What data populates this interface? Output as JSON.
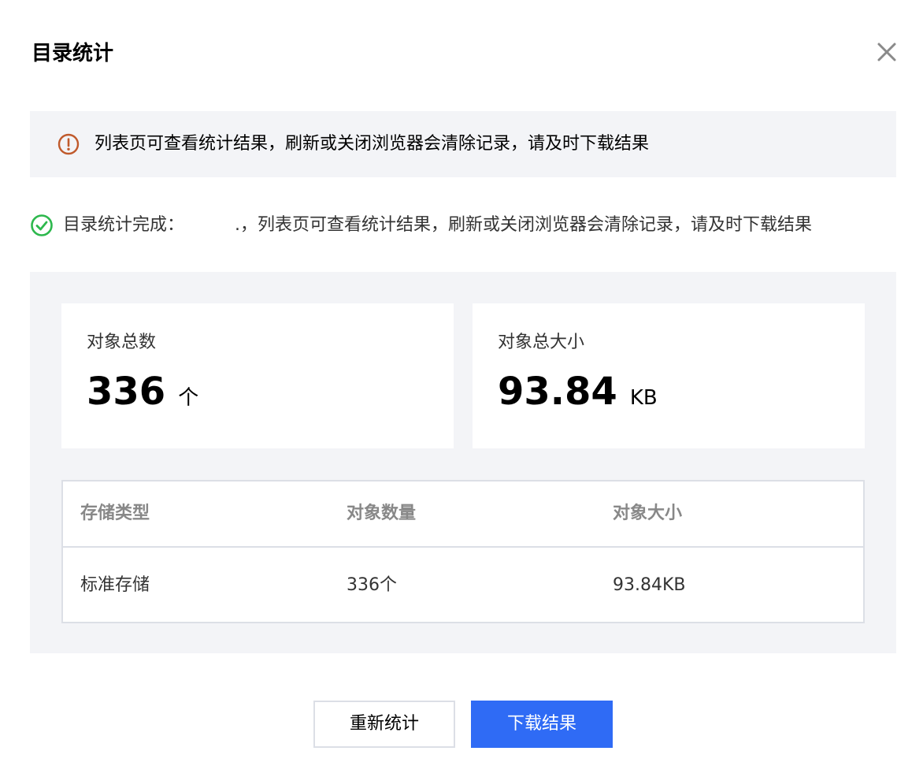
{
  "dialog": {
    "title": "目录统计",
    "close_icon": "close-icon"
  },
  "notice": {
    "icon": "warning-circle-icon",
    "color": "#c05a2c",
    "text": "列表页可查看统计结果，刷新或关闭浏览器会清除记录，请及时下载结果"
  },
  "status": {
    "icon": "check-circle-icon",
    "color": "#2db84d",
    "prefix": "目录统计完成：",
    "suffix": ".，列表页可查看统计结果，刷新或关闭浏览器会清除记录，请及时下载结果"
  },
  "summary": {
    "count": {
      "label": "对象总数",
      "value": "336",
      "unit": "个"
    },
    "size": {
      "label": "对象总大小",
      "value": "93.84",
      "unit": "KB"
    }
  },
  "table": {
    "headers": [
      "存储类型",
      "对象数量",
      "对象大小"
    ],
    "rows": [
      [
        "标准存储",
        "336个",
        "93.84KB"
      ]
    ]
  },
  "buttons": {
    "recount": "重新统计",
    "download": "下载结果"
  },
  "colors": {
    "primary": "#2f6bf5",
    "panel_bg": "#f3f4f7",
    "border": "#dcdfe6"
  }
}
